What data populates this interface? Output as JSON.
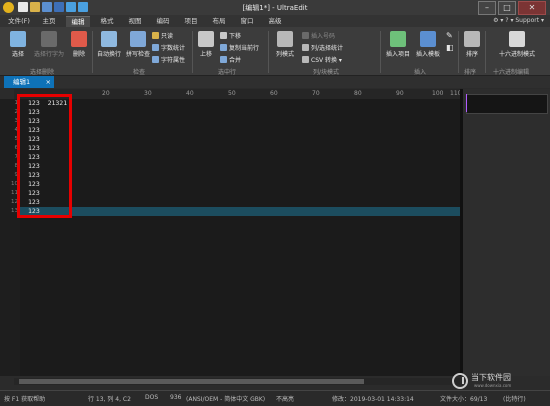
{
  "window": {
    "title": "[编辑1*] - UltraEdit"
  },
  "menu": {
    "tabs": [
      "文件(F)",
      "主页",
      "编辑",
      "格式",
      "视图",
      "编码",
      "项目",
      "布局",
      "窗口",
      "高级"
    ],
    "active_index": 2,
    "support": "Support"
  },
  "ribbon": {
    "select": "选择",
    "select_as": "选择行字为",
    "delete": "删除",
    "group_select_delete": "选择删除",
    "auto_wrap": "自动换行",
    "spell_check": "拼写检查",
    "read_only": "只读",
    "word_count": "字数统计",
    "char_props": "字符属性",
    "group_check": "检查",
    "move_up": "上移",
    "move_down": "下移",
    "copy_current_line": "复制当前行",
    "merge": "合并",
    "group_selected_lines": "选中行",
    "column_mode": "列模式",
    "insert_number": "插入号码",
    "column_sel_stats": "列/选择统计",
    "csv_convert": "CSV 转换",
    "group_column_block": "列/块模式",
    "insert_item": "插入项目",
    "insert_template": "插入模板",
    "group_insert": "插入",
    "sort": "排序",
    "group_sort": "排序",
    "hex_mode": "十六进制模式",
    "group_hex": "十六进制编辑"
  },
  "doc_tab": {
    "label": "编辑1",
    "close": "×"
  },
  "ruler": {
    "numbers": [
      "20",
      "30",
      "40",
      "50",
      "60",
      "70",
      "80",
      "90",
      "100",
      "110"
    ]
  },
  "editor": {
    "line_numbers": [
      "1",
      "2",
      "3",
      "4",
      "5",
      "6",
      "7",
      "8",
      "9",
      "10",
      "11",
      "12",
      "13"
    ],
    "lines": [
      "123  21321",
      "123",
      "123",
      "123",
      "123",
      "123",
      "123",
      "123",
      "123",
      "123",
      "123",
      "123",
      "123"
    ],
    "current_line": 13
  },
  "status": {
    "help": "按 F1 获取帮助",
    "position": "行 13, 列 4, C2",
    "line_ending": "DOS",
    "codepage": "936",
    "encoding": "(ANSI/OEM - 简体中文 GBK)",
    "highlight": "不高亮",
    "modified": "修改：2019-03-01 14:33:14",
    "file_size": "文件大小：69/13",
    "compare": "(比特行)"
  },
  "watermark": {
    "name": "当下软件园",
    "sub": "www.downxia.com"
  },
  "colors": {
    "accent": "#0e72b8",
    "highlight": "#e60000",
    "current_line": "#1c4d5f"
  }
}
